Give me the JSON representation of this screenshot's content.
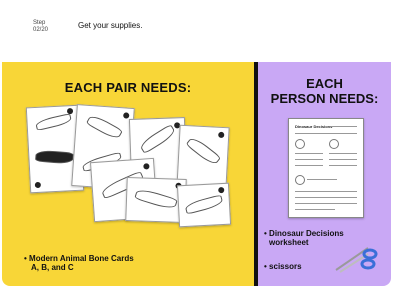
{
  "header": {
    "step_label": "Step",
    "step_number": "02/20",
    "title": "Get your supplies."
  },
  "pair_panel": {
    "heading": "EACH PAIR NEEDS:",
    "item": "Modern Animal Bone Cards A, B, and C",
    "item_line1": "Modern Animal Bone Cards",
    "item_line2": "A, B, and C",
    "bullet": "•"
  },
  "person_panel": {
    "heading_line1": "EACH",
    "heading_line2": "PERSON NEEDS:",
    "worksheet_title": "Dinosaur Decisions",
    "items": [
      {
        "line1": "Dinosaur Decisions",
        "line2": "worksheet"
      },
      {
        "line1": "scissors"
      }
    ],
    "bullet": "•"
  },
  "colors": {
    "yellow": "#f8d637",
    "purple": "#c9a8f5",
    "divider": "#111111",
    "scissors_handle": "#3a6fd8"
  },
  "icons": [
    "bone-card-image",
    "worksheet-image",
    "scissors-icon"
  ]
}
